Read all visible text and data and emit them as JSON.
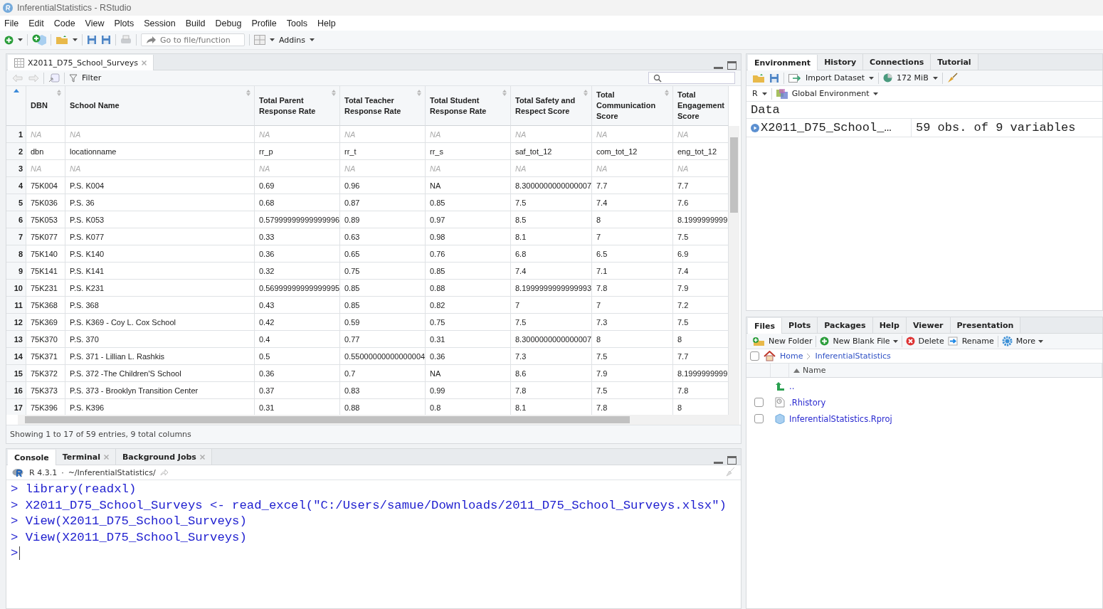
{
  "window": {
    "title": "InferentialStatistics - RStudio"
  },
  "menu": [
    "File",
    "Edit",
    "Code",
    "View",
    "Plots",
    "Session",
    "Build",
    "Debug",
    "Profile",
    "Tools",
    "Help"
  ],
  "toolbar": {
    "goto_placeholder": "Go to file/function",
    "addins": "Addins"
  },
  "data_viewer": {
    "tab": "X2011_D75_School_Surveys",
    "filter": "Filter",
    "columns": [
      "DBN",
      "School Name",
      "Total Parent Response Rate",
      "Total Teacher Response Rate",
      "Total Student Response Rate",
      "Total Safety and Respect Score",
      "Total Communication Score",
      "Total Engagement Score"
    ],
    "rows": [
      {
        "number": "1",
        "missing": true,
        "cells": [
          "NA",
          "NA",
          "NA",
          "NA",
          "NA",
          "NA",
          "NA",
          "NA"
        ]
      },
      {
        "number": "2",
        "missing": false,
        "cells": [
          "dbn",
          "locationname",
          "rr_p",
          "rr_t",
          "rr_s",
          "saf_tot_12",
          "com_tot_12",
          "eng_tot_12"
        ]
      },
      {
        "number": "3",
        "missing": true,
        "cells": [
          "NA",
          "NA",
          "NA",
          "NA",
          "NA",
          "NA",
          "NA",
          "NA"
        ]
      },
      {
        "number": "4",
        "missing": false,
        "cells": [
          "75K004",
          "P.S. K004",
          "0.69",
          "0.96",
          "NA",
          "8.3000000000000007",
          "7.7",
          "7.7"
        ]
      },
      {
        "number": "5",
        "missing": false,
        "cells": [
          "75K036",
          "P.S. 36",
          "0.68",
          "0.87",
          "0.85",
          "7.5",
          "7.4",
          "7.6"
        ]
      },
      {
        "number": "6",
        "missing": false,
        "cells": [
          "75K053",
          "P.S. K053",
          "0.57999999999999996",
          "0.89",
          "0.97",
          "8.5",
          "8",
          "8.1999999999"
        ]
      },
      {
        "number": "7",
        "missing": false,
        "cells": [
          "75K077",
          "P.S. K077",
          "0.33",
          "0.63",
          "0.98",
          "8.1",
          "7",
          "7.5"
        ]
      },
      {
        "number": "8",
        "missing": false,
        "cells": [
          "75K140",
          "P.S. K140",
          "0.36",
          "0.65",
          "0.76",
          "6.8",
          "6.5",
          "6.9"
        ]
      },
      {
        "number": "9",
        "missing": false,
        "cells": [
          "75K141",
          "P.S. K141",
          "0.32",
          "0.75",
          "0.85",
          "7.4",
          "7.1",
          "7.4"
        ]
      },
      {
        "number": "10",
        "missing": false,
        "cells": [
          "75K231",
          "P.S. K231",
          "0.56999999999999995",
          "0.85",
          "0.88",
          "8.1999999999999993",
          "7.8",
          "7.9"
        ]
      },
      {
        "number": "11",
        "missing": false,
        "cells": [
          "75K368",
          "P.S. 368",
          "0.43",
          "0.85",
          "0.82",
          "7",
          "7",
          "7.2"
        ]
      },
      {
        "number": "12",
        "missing": false,
        "cells": [
          "75K369",
          "P.S. K369 - Coy L. Cox School",
          "0.42",
          "0.59",
          "0.75",
          "7.5",
          "7.3",
          "7.5"
        ]
      },
      {
        "number": "13",
        "missing": false,
        "cells": [
          "75K370",
          "P.S. 370",
          "0.4",
          "0.77",
          "0.31",
          "8.3000000000000007",
          "8",
          "8"
        ]
      },
      {
        "number": "14",
        "missing": false,
        "cells": [
          "75K371",
          "P.S. 371 - Lillian L. Rashkis",
          "0.5",
          "0.55000000000000004",
          "0.36",
          "7.3",
          "7.5",
          "7.7"
        ]
      },
      {
        "number": "15",
        "missing": false,
        "cells": [
          "75K372",
          "P.S. 372 -The Children'S School",
          "0.36",
          "0.7",
          "NA",
          "8.6",
          "7.9",
          "8.1999999999"
        ]
      },
      {
        "number": "16",
        "missing": false,
        "cells": [
          "75K373",
          "P.S. 373 - Brooklyn Transition Center",
          "0.37",
          "0.83",
          "0.99",
          "7.8",
          "7.5",
          "7.8"
        ]
      },
      {
        "number": "17",
        "missing": false,
        "cells": [
          "75K396",
          "P.S. K396",
          "0.31",
          "0.88",
          "0.8",
          "8.1",
          "7.8",
          "8"
        ]
      }
    ],
    "footer": "Showing 1 to 17 of 59 entries, 9 total columns"
  },
  "console": {
    "tabs": [
      {
        "label": "Console",
        "selected": true,
        "closable": false
      },
      {
        "label": "Terminal",
        "selected": false,
        "closable": true
      },
      {
        "label": "Background Jobs",
        "selected": false,
        "closable": true
      }
    ],
    "version": "R 4.3.1",
    "separator": "·",
    "path": "~/InferentialStatistics/",
    "lines": [
      {
        "prompt": ">",
        "text": "library(readxl)"
      },
      {
        "prompt": ">",
        "text": "X2011_D75_School_Surveys <- read_excel(\"C:/Users/samue/Downloads/2011_D75_School_Surveys.xlsx\")"
      },
      {
        "prompt": ">",
        "text": "View(X2011_D75_School_Surveys)"
      },
      {
        "prompt": ">",
        "text": "View(X2011_D75_School_Surveys)"
      },
      {
        "prompt": ">"
      }
    ]
  },
  "environment": {
    "tabs": [
      {
        "label": "Environment",
        "selected": true
      },
      {
        "label": "History",
        "selected": false
      },
      {
        "label": "Connections",
        "selected": false
      },
      {
        "label": "Tutorial",
        "selected": false
      }
    ],
    "import": "Import Dataset",
    "memory": "172 MiB",
    "language": "R",
    "scope": "Global Environment",
    "section": "Data",
    "items": [
      {
        "name": "X2011_D75_School_…",
        "value": "59 obs. of 9 variables"
      }
    ]
  },
  "files": {
    "tabs": [
      {
        "label": "Files",
        "selected": true
      },
      {
        "label": "Plots",
        "selected": false
      },
      {
        "label": "Packages",
        "selected": false
      },
      {
        "label": "Help",
        "selected": false
      },
      {
        "label": "Viewer",
        "selected": false
      },
      {
        "label": "Presentation",
        "selected": false
      }
    ],
    "actions": [
      {
        "kind": "folder",
        "label": "New Folder",
        "menu": false
      },
      {
        "kind": "new",
        "label": "New Blank File",
        "menu": true
      },
      {
        "kind": "delete",
        "label": "Delete",
        "menu": false
      },
      {
        "kind": "rename",
        "label": "Rename",
        "menu": false
      },
      {
        "kind": "more",
        "label": "More",
        "menu": true
      }
    ],
    "select_all_checked": false,
    "breadcrumb": [
      "Home",
      "InferentialStatistics"
    ],
    "name_header": "Name",
    "entries": [
      {
        "kind": "up",
        "name": ".."
      },
      {
        "kind": "history",
        "name": ".Rhistory",
        "checked": false
      },
      {
        "kind": "project",
        "name": "InferentialStatistics.Rproj",
        "checked": false
      }
    ]
  }
}
